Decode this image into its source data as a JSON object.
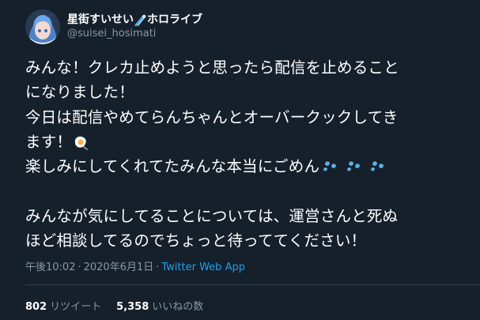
{
  "user": {
    "display_name_part1": "星街すいせい",
    "display_name_part2": "ホロライブ",
    "handle": "@suisei_hosimati",
    "avatar_icon": "avatar-image",
    "name_emoji": "comet-emoji"
  },
  "tweet": {
    "line1": "みんな！クレカ止めようと思ったら配信を止めること",
    "line2": "になりました！",
    "line3": "今日は配信やめてらんちゃんとオーバークックしてき",
    "line4": "ます！",
    "line4_emoji": "fried-egg-emoji",
    "line5": "楽しみにしてくれてたみんな本当にごめん",
    "line5_emoji": "sweat-droplets-emoji",
    "line6": "みんなが気にしてることについては、運営さんと死ぬ",
    "line7": "ほど相談してるのでちょっと待っててください！"
  },
  "meta": {
    "time": "午後10:02",
    "separator": "·",
    "date": "2020年6月1日",
    "app": "Twitter Web App"
  },
  "stats": {
    "retweets_count": "802",
    "retweets_label": "リツイート",
    "likes_count": "5,358",
    "likes_label": "いいねの数"
  },
  "colors": {
    "background": "#15202b",
    "text": "#ffffff",
    "secondary": "#8899a6",
    "link": "#1da1f2",
    "divider": "#38444d"
  }
}
